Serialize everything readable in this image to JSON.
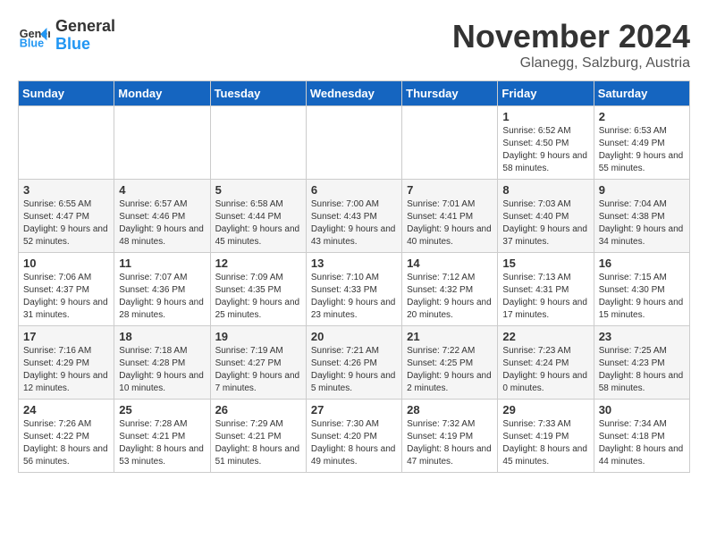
{
  "header": {
    "logo": {
      "line1": "General",
      "line2": "Blue"
    },
    "title": "November 2024",
    "location": "Glanegg, Salzburg, Austria"
  },
  "weekdays": [
    "Sunday",
    "Monday",
    "Tuesday",
    "Wednesday",
    "Thursday",
    "Friday",
    "Saturday"
  ],
  "weeks": [
    [
      {
        "day": "",
        "info": ""
      },
      {
        "day": "",
        "info": ""
      },
      {
        "day": "",
        "info": ""
      },
      {
        "day": "",
        "info": ""
      },
      {
        "day": "",
        "info": ""
      },
      {
        "day": "1",
        "info": "Sunrise: 6:52 AM\nSunset: 4:50 PM\nDaylight: 9 hours and 58 minutes."
      },
      {
        "day": "2",
        "info": "Sunrise: 6:53 AM\nSunset: 4:49 PM\nDaylight: 9 hours and 55 minutes."
      }
    ],
    [
      {
        "day": "3",
        "info": "Sunrise: 6:55 AM\nSunset: 4:47 PM\nDaylight: 9 hours and 52 minutes."
      },
      {
        "day": "4",
        "info": "Sunrise: 6:57 AM\nSunset: 4:46 PM\nDaylight: 9 hours and 48 minutes."
      },
      {
        "day": "5",
        "info": "Sunrise: 6:58 AM\nSunset: 4:44 PM\nDaylight: 9 hours and 45 minutes."
      },
      {
        "day": "6",
        "info": "Sunrise: 7:00 AM\nSunset: 4:43 PM\nDaylight: 9 hours and 43 minutes."
      },
      {
        "day": "7",
        "info": "Sunrise: 7:01 AM\nSunset: 4:41 PM\nDaylight: 9 hours and 40 minutes."
      },
      {
        "day": "8",
        "info": "Sunrise: 7:03 AM\nSunset: 4:40 PM\nDaylight: 9 hours and 37 minutes."
      },
      {
        "day": "9",
        "info": "Sunrise: 7:04 AM\nSunset: 4:38 PM\nDaylight: 9 hours and 34 minutes."
      }
    ],
    [
      {
        "day": "10",
        "info": "Sunrise: 7:06 AM\nSunset: 4:37 PM\nDaylight: 9 hours and 31 minutes."
      },
      {
        "day": "11",
        "info": "Sunrise: 7:07 AM\nSunset: 4:36 PM\nDaylight: 9 hours and 28 minutes."
      },
      {
        "day": "12",
        "info": "Sunrise: 7:09 AM\nSunset: 4:35 PM\nDaylight: 9 hours and 25 minutes."
      },
      {
        "day": "13",
        "info": "Sunrise: 7:10 AM\nSunset: 4:33 PM\nDaylight: 9 hours and 23 minutes."
      },
      {
        "day": "14",
        "info": "Sunrise: 7:12 AM\nSunset: 4:32 PM\nDaylight: 9 hours and 20 minutes."
      },
      {
        "day": "15",
        "info": "Sunrise: 7:13 AM\nSunset: 4:31 PM\nDaylight: 9 hours and 17 minutes."
      },
      {
        "day": "16",
        "info": "Sunrise: 7:15 AM\nSunset: 4:30 PM\nDaylight: 9 hours and 15 minutes."
      }
    ],
    [
      {
        "day": "17",
        "info": "Sunrise: 7:16 AM\nSunset: 4:29 PM\nDaylight: 9 hours and 12 minutes."
      },
      {
        "day": "18",
        "info": "Sunrise: 7:18 AM\nSunset: 4:28 PM\nDaylight: 9 hours and 10 minutes."
      },
      {
        "day": "19",
        "info": "Sunrise: 7:19 AM\nSunset: 4:27 PM\nDaylight: 9 hours and 7 minutes."
      },
      {
        "day": "20",
        "info": "Sunrise: 7:21 AM\nSunset: 4:26 PM\nDaylight: 9 hours and 5 minutes."
      },
      {
        "day": "21",
        "info": "Sunrise: 7:22 AM\nSunset: 4:25 PM\nDaylight: 9 hours and 2 minutes."
      },
      {
        "day": "22",
        "info": "Sunrise: 7:23 AM\nSunset: 4:24 PM\nDaylight: 9 hours and 0 minutes."
      },
      {
        "day": "23",
        "info": "Sunrise: 7:25 AM\nSunset: 4:23 PM\nDaylight: 8 hours and 58 minutes."
      }
    ],
    [
      {
        "day": "24",
        "info": "Sunrise: 7:26 AM\nSunset: 4:22 PM\nDaylight: 8 hours and 56 minutes."
      },
      {
        "day": "25",
        "info": "Sunrise: 7:28 AM\nSunset: 4:21 PM\nDaylight: 8 hours and 53 minutes."
      },
      {
        "day": "26",
        "info": "Sunrise: 7:29 AM\nSunset: 4:21 PM\nDaylight: 8 hours and 51 minutes."
      },
      {
        "day": "27",
        "info": "Sunrise: 7:30 AM\nSunset: 4:20 PM\nDaylight: 8 hours and 49 minutes."
      },
      {
        "day": "28",
        "info": "Sunrise: 7:32 AM\nSunset: 4:19 PM\nDaylight: 8 hours and 47 minutes."
      },
      {
        "day": "29",
        "info": "Sunrise: 7:33 AM\nSunset: 4:19 PM\nDaylight: 8 hours and 45 minutes."
      },
      {
        "day": "30",
        "info": "Sunrise: 7:34 AM\nSunset: 4:18 PM\nDaylight: 8 hours and 44 minutes."
      }
    ]
  ]
}
